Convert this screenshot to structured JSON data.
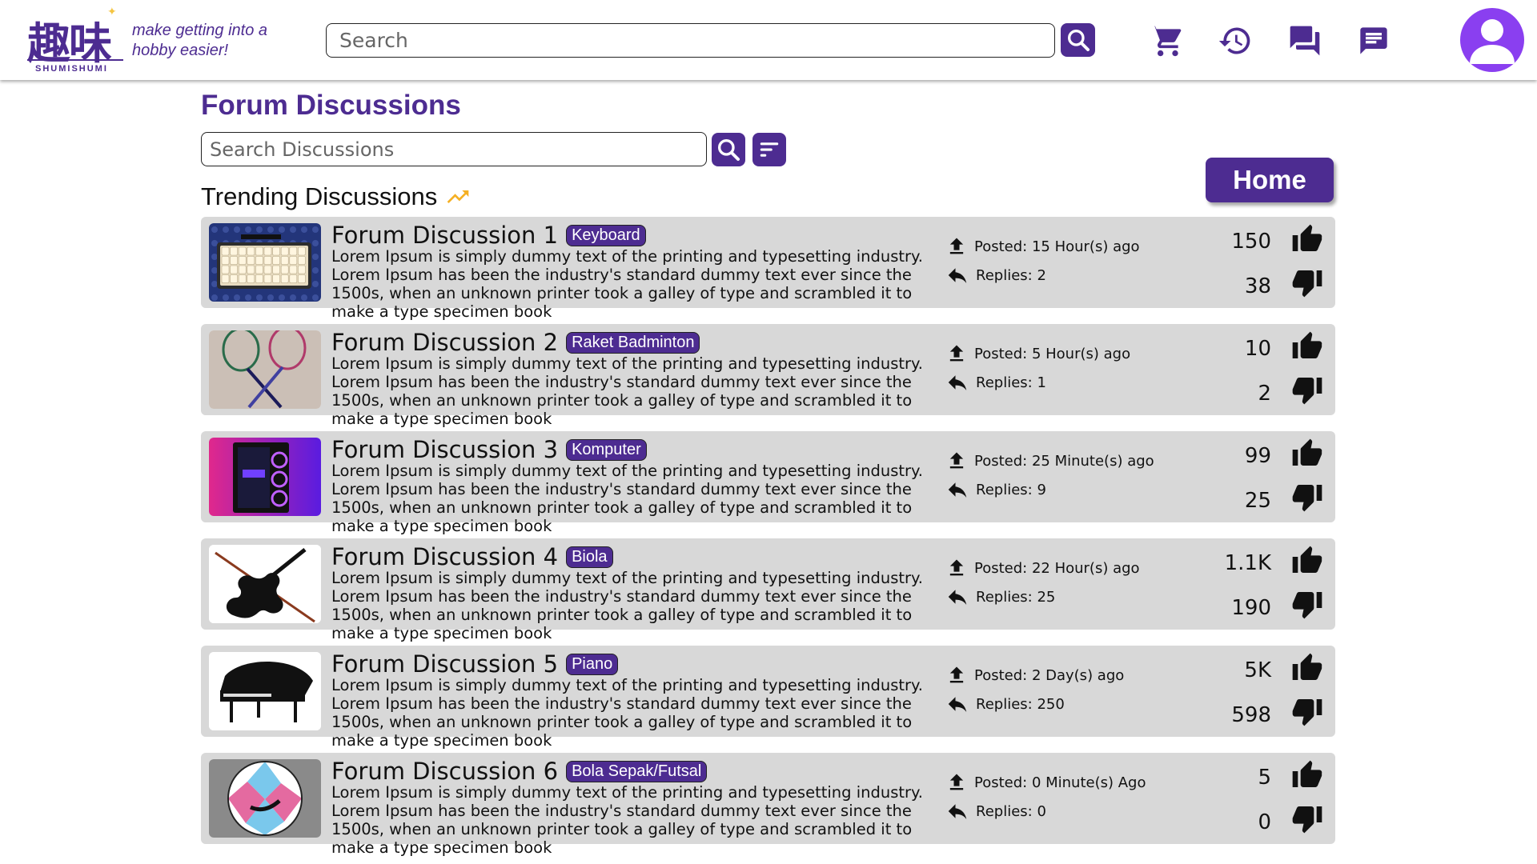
{
  "header": {
    "logo_kanji": "趣味",
    "logo_text": "SHUMISHUMI",
    "tagline": "make getting into a hobby easier!",
    "search_placeholder": "Search"
  },
  "page": {
    "title": "Forum Discussions",
    "search_placeholder": "Search Discussions",
    "trending_label": "Trending Discussions",
    "home_label": "Home"
  },
  "colors": {
    "brand": "#4d2c91",
    "avatar": "#8a3ff0",
    "card_bg": "#d8d8d8"
  },
  "discussions": [
    {
      "title": "Forum Discussion 1",
      "tag": "Keyboard",
      "description": "Lorem Ipsum is simply dummy text of the printing and typesetting industry. Lorem Ipsum has been the industry's standard dummy text ever since the 1500s, when an unknown printer took a galley of type and scrambled it to make a type specimen book",
      "posted": "Posted: 15 Hour(s) ago",
      "replies": "Replies: 2",
      "likes": "150",
      "dislikes": "38",
      "image": "keyboard"
    },
    {
      "title": "Forum Discussion 2",
      "tag": "Raket Badminton",
      "description": "Lorem Ipsum is simply dummy text of the printing and typesetting industry. Lorem Ipsum has been the industry's standard dummy text ever since the 1500s, when an unknown printer took a galley of type and scrambled it to make a type specimen book",
      "posted": "Posted: 5 Hour(s) ago",
      "replies": "Replies: 1",
      "likes": "10",
      "dislikes": "2",
      "image": "badminton"
    },
    {
      "title": "Forum Discussion 3",
      "tag": "Komputer",
      "description": "Lorem Ipsum is simply dummy text of the printing and typesetting industry. Lorem Ipsum has been the industry's standard dummy text ever since the 1500s, when an unknown printer took a galley of type and scrambled it to make a type specimen book",
      "posted": "Posted: 25 Minute(s) ago",
      "replies": "Replies: 9",
      "likes": "99",
      "dislikes": "25",
      "image": "computer"
    },
    {
      "title": "Forum Discussion 4",
      "tag": "Biola",
      "description": "Lorem Ipsum is simply dummy text of the printing and typesetting industry. Lorem Ipsum has been the industry's standard dummy text ever since the 1500s, when an unknown printer took a galley of type and scrambled it to make a type specimen book",
      "posted": "Posted: 22 Hour(s) ago",
      "replies": "Replies: 25",
      "likes": "1.1K",
      "dislikes": "190",
      "image": "violin"
    },
    {
      "title": "Forum Discussion 5",
      "tag": "Piano",
      "description": "Lorem Ipsum is simply dummy text of the printing and typesetting industry. Lorem Ipsum has been the industry's standard dummy text ever since the 1500s, when an unknown printer took a galley of type and scrambled it to make a type specimen book",
      "posted": "Posted: 2 Day(s) ago",
      "replies": "Replies: 250",
      "likes": "5K",
      "dislikes": "598",
      "image": "piano"
    },
    {
      "title": "Forum Discussion 6",
      "tag": "Bola Sepak/Futsal",
      "description": "Lorem Ipsum is simply dummy text of the printing and typesetting industry. Lorem Ipsum has been the industry's standard dummy text ever since the 1500s, when an unknown printer took a galley of type and scrambled it to make a type specimen book",
      "posted": "Posted: 0 Minute(s) Ago",
      "replies": "Replies: 0",
      "likes": "5",
      "dislikes": "0",
      "image": "football"
    }
  ]
}
